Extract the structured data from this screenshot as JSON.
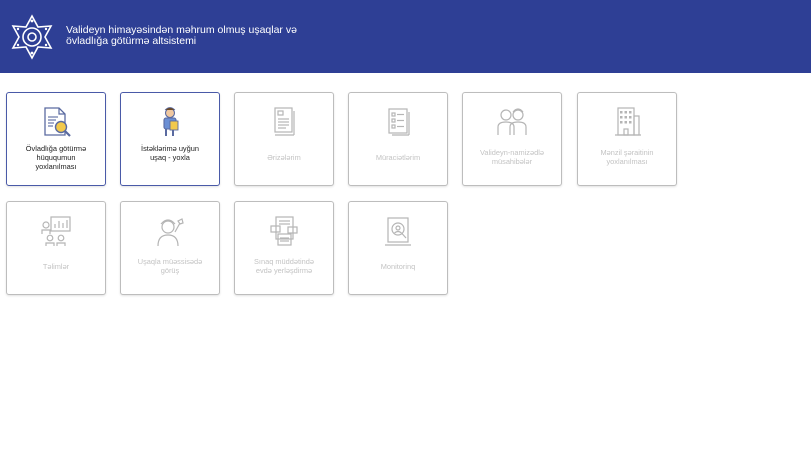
{
  "header": {
    "title_line1": "Valideyn himayəsindən məhrum olmuş uşaqlar və",
    "title_line2": "övladlığa götürmə altsistemi",
    "logo_icon": "emblem-logo-icon",
    "background_color": "#2e3f95"
  },
  "tiles": [
    {
      "label_lines": [
        "Övladlığa götürmə",
        "hüququmun",
        "yoxlanılması"
      ],
      "icon": "document-search-icon",
      "enabled": true
    },
    {
      "label_lines": [
        "İstəklərimə uyğun",
        "uşaq - yoxla"
      ],
      "icon": "child-check-icon",
      "enabled": true
    },
    {
      "label_lines": [
        "Ərizələrim"
      ],
      "icon": "applications-icon",
      "enabled": false
    },
    {
      "label_lines": [
        "Müraciətlərim"
      ],
      "icon": "requests-icon",
      "enabled": false
    },
    {
      "label_lines": [
        "Valideyn-namizədlə",
        "müsahibələr"
      ],
      "icon": "parents-icon",
      "enabled": false
    },
    {
      "label_lines": [
        "Mənzil şəraitinin",
        "yoxlanılması"
      ],
      "icon": "building-icon",
      "enabled": false
    },
    {
      "label_lines": [
        "Təlimlər"
      ],
      "icon": "training-icon",
      "enabled": false
    },
    {
      "label_lines": [
        "Uşaqla müəssisədə",
        "görüş"
      ],
      "icon": "meeting-icon",
      "enabled": false
    },
    {
      "label_lines": [
        "Sınaq müddətində",
        "evdə yerləşdirmə"
      ],
      "icon": "trial-placement-icon",
      "enabled": false
    },
    {
      "label_lines": [
        "Monitorinq"
      ],
      "icon": "monitoring-icon",
      "enabled": false
    }
  ],
  "colors": {
    "active_border": "#4a5aa8",
    "inactive_text": "#c3c3c3",
    "active_text": "#222222"
  }
}
